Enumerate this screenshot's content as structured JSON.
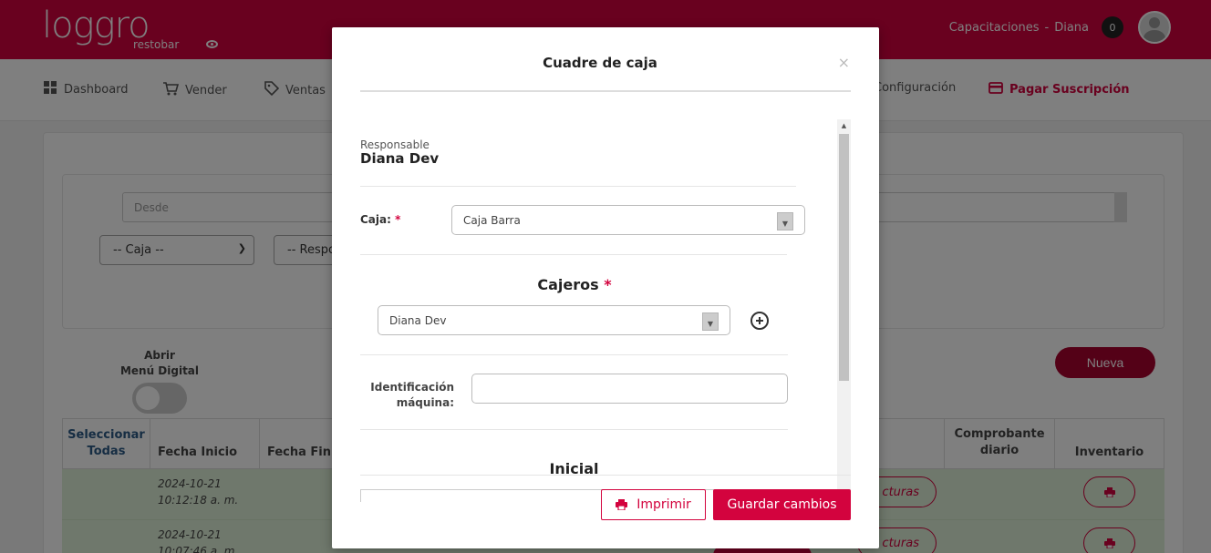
{
  "brand": {
    "logo_main": "loggro",
    "logo_sub": "restobar"
  },
  "header": {
    "company": "Capacitaciones",
    "separator": "-",
    "user": "Diana",
    "notifications": "0"
  },
  "nav": {
    "dashboard": "Dashboard",
    "vender": "Vender",
    "ventas": "Ventas",
    "configuracion": "Configuración",
    "pagar": "Pagar Suscripción"
  },
  "filters": {
    "desde_placeholder": "Desde",
    "caja_select": "-- Caja --",
    "responsable_select": "-- Respo"
  },
  "menu_digital": {
    "line1": "Abrir",
    "line2": "Menú Digital"
  },
  "nueva_label": "Nueva",
  "table": {
    "headers": {
      "seleccionar": "Seleccionar Todas",
      "fecha_inicio": "Fecha Inicio",
      "fecha_fin": "Fecha Fin",
      "comprobante": "Comprobante diario",
      "inventario": "Inventario"
    },
    "rows": [
      {
        "date": "2024-10-21",
        "time": "10:12:18 a. m.",
        "facturas": "cturas"
      },
      {
        "date": "2024-10-21",
        "time": "10:07:46 a. m.",
        "facturas": "cturas"
      }
    ]
  },
  "modal": {
    "title": "Cuadre de caja",
    "close": "×",
    "responsable_label": "Responsable",
    "responsable_name": "Diana Dev",
    "caja_label": "Caja:",
    "required_mark": "*",
    "caja_value": "Caja Barra",
    "cajeros_title": "Cajeros",
    "cajero_value": "Diana Dev",
    "ident_label_1": "Identificación",
    "ident_label_2": "máquina:",
    "ident_value": "",
    "inicial_title": "Inicial",
    "imprimir": "Imprimir",
    "guardar": "Guardar cambios"
  },
  "colors": {
    "brand": "#d3033e",
    "brand_dark": "#a8032f",
    "row_success": "#dff0d8"
  }
}
